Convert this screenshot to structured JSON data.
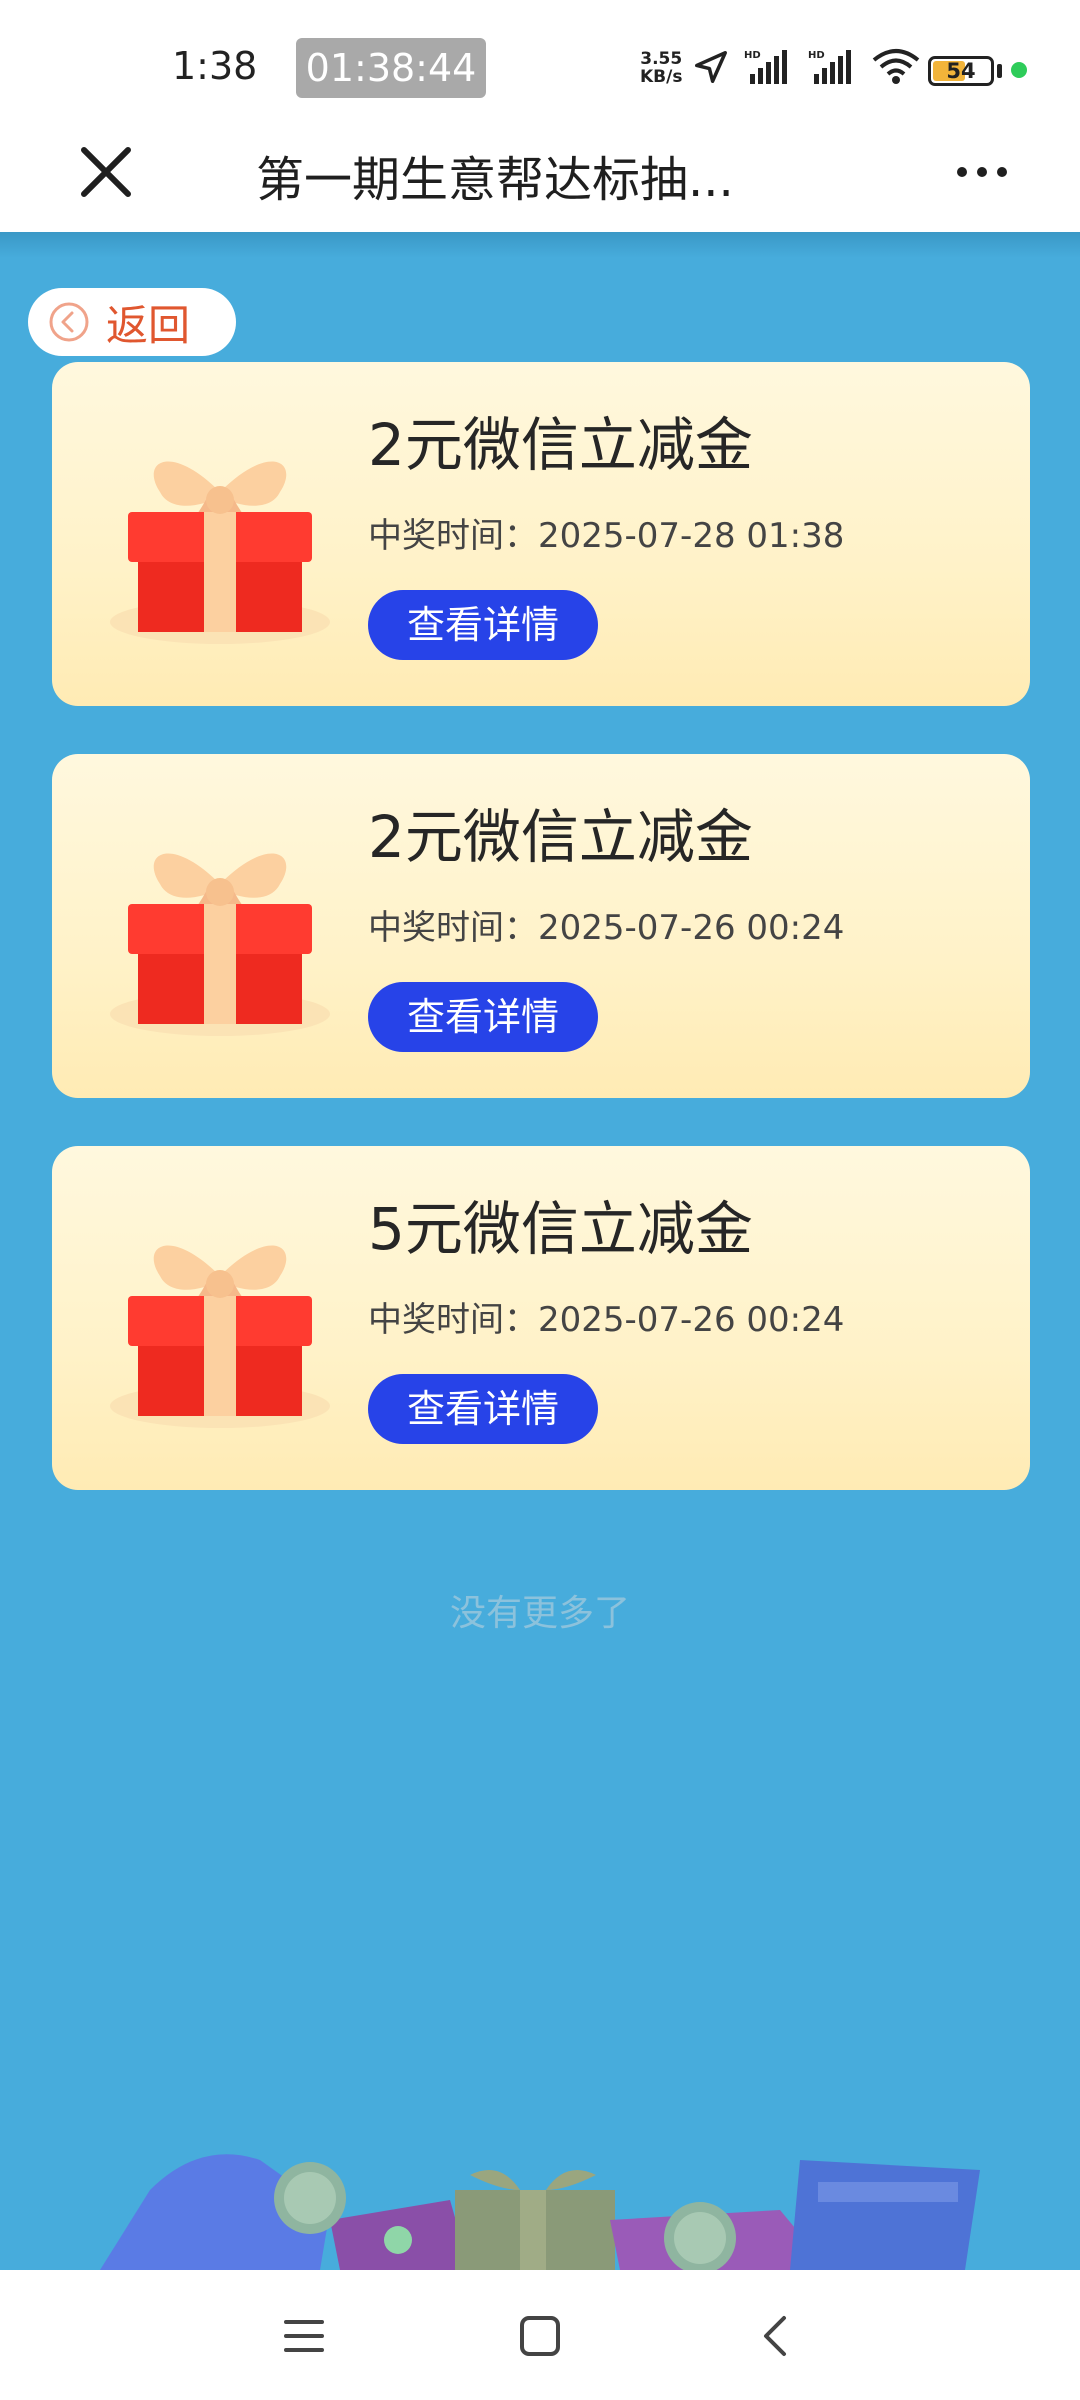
{
  "status_bar": {
    "time": "1:38",
    "timer": "01:38:44",
    "net_speed_value": "3.55",
    "net_speed_unit": "KB/s",
    "battery_level": "54",
    "battery_fraction": 0.54,
    "icons": [
      "location-arrow-icon",
      "hd-signal-icon",
      "hd-signal-icon",
      "wifi-icon",
      "battery-icon"
    ]
  },
  "nav": {
    "title": "第一期生意帮达标抽...",
    "close_icon": "close-icon",
    "more_icon": "more-icon"
  },
  "back_button": {
    "label": "返回",
    "icon": "chevron-left-circle-icon"
  },
  "prizes": [
    {
      "title": "2元微信立减金",
      "time": "中奖时间：2025-07-28 01:38",
      "button": "查看详情"
    },
    {
      "title": "2元微信立减金",
      "time": "中奖时间：2025-07-26 00:24",
      "button": "查看详情"
    },
    {
      "title": "5元微信立减金",
      "time": "中奖时间：2025-07-26 00:24",
      "button": "查看详情"
    }
  ],
  "footer": {
    "no_more": "没有更多了"
  },
  "system_nav": {
    "icons": [
      "menu-icon",
      "home-icon",
      "back-icon"
    ]
  },
  "colors": {
    "page_background": "#47acdc",
    "button_blue": "#2743e8",
    "back_label": "#e0572f",
    "card_background": "#fff2c8"
  }
}
